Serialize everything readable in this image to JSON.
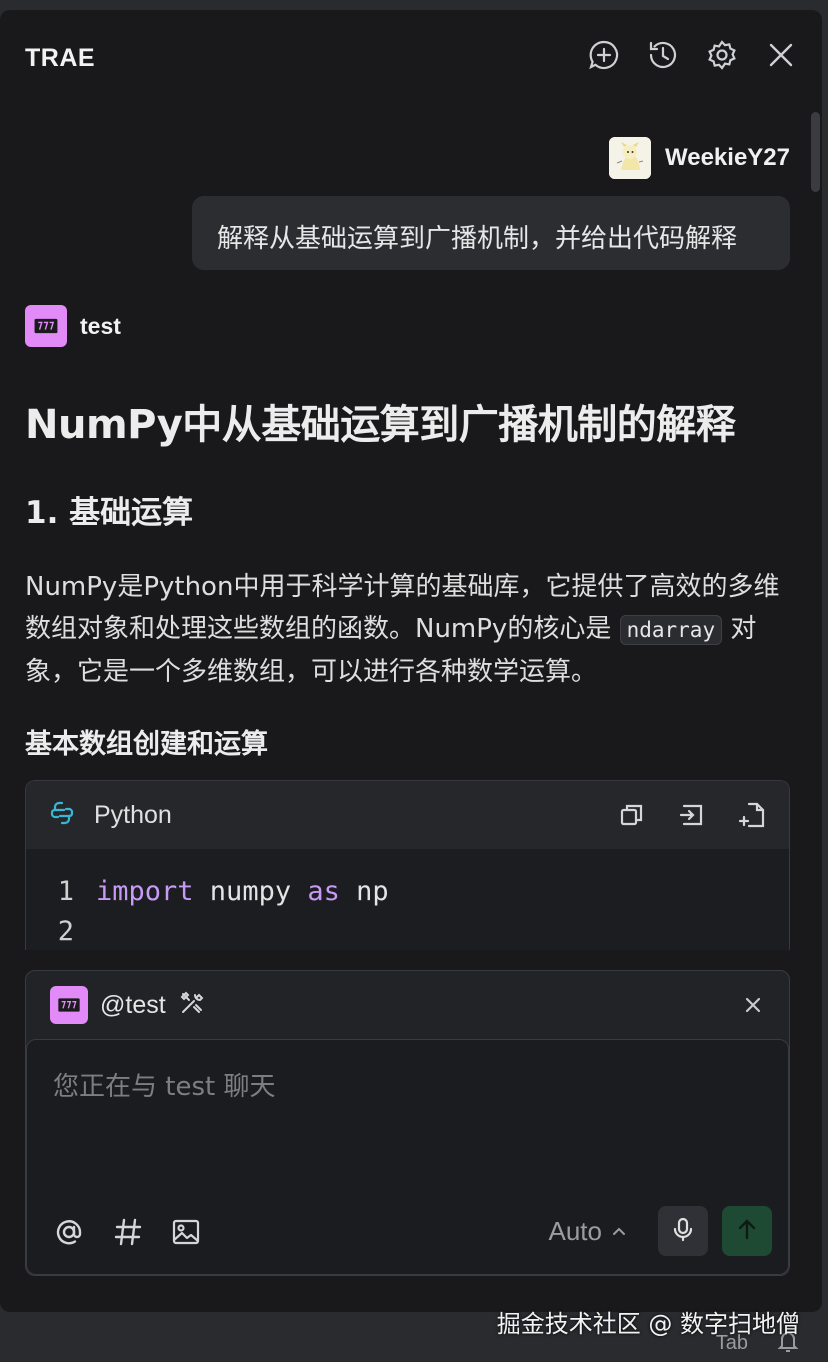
{
  "app": {
    "title": "TRAE"
  },
  "toolbar": {
    "icons": [
      "new-chat-icon",
      "history-icon",
      "settings-icon",
      "close-icon"
    ]
  },
  "conversation": {
    "user": {
      "name": "WeekieY27",
      "message": "解释从基础运算到广播机制，并给出代码解释"
    },
    "bot": {
      "name": "test"
    },
    "response": {
      "h1": "NumPy中从基础运算到广播机制的解释",
      "h2": "1. 基础运算",
      "para_before_code": "NumPy是Python中用于科学计算的基础库，它提供了高效的多维数组对象和处理这些数组的函数。NumPy的核心是",
      "inline_code": "ndarray",
      "para_after_code": "对象，它是一个多维数组，可以进行各种数学运算。",
      "h3": "基本数组创建和运算",
      "code_block": {
        "language": "Python",
        "lines": [
          {
            "num": "1",
            "kw1": "import",
            "t1": " numpy ",
            "kw2": "as",
            "t2": " np"
          },
          {
            "num": "2",
            "kw1": "",
            "t1": "",
            "kw2": "",
            "t2": ""
          }
        ]
      }
    }
  },
  "composer": {
    "mention": "@test",
    "placeholder": "您正在与 test 聊天",
    "mode": "Auto"
  },
  "statusbar": {
    "tab_label": "Tab"
  },
  "watermark": "掘金技术社区 @ 数字扫地僧",
  "colors": {
    "accent_send": "#1e4a33",
    "keyword": "#c79af6",
    "bot_avatar": "#e28af7"
  }
}
